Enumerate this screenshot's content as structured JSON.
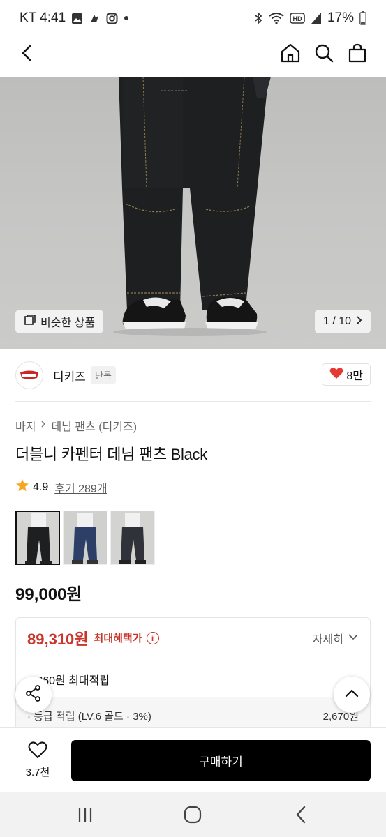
{
  "status_bar": {
    "carrier_time": "KT 4:41",
    "left_icons": [
      "gallery-icon",
      "app-notification-icon",
      "instagram-icon",
      "more-dot-icon"
    ],
    "right_icons": [
      "bluetooth-icon",
      "wifi-icon",
      "hd-voice-icon",
      "signal-icon"
    ],
    "battery": "17%"
  },
  "top_nav": {
    "icons": [
      "back-arrow-icon",
      "home-icon",
      "search-icon",
      "shopping-bag-icon"
    ]
  },
  "hero": {
    "similar_label": "비슷한 상품",
    "counter": "1 / 10"
  },
  "brand": {
    "name": "디키즈",
    "badge": "단독",
    "likes": "8만"
  },
  "product": {
    "breadcrumb": [
      "바지",
      "데님 팬츠 (디키즈)"
    ],
    "title": "더블니 카펜터 데님 팬츠 Black",
    "rating": "4.9",
    "reviews": "후기 289개",
    "price": "99,000원",
    "thumbnails": [
      "black",
      "indigo",
      "charcoal"
    ]
  },
  "benefit": {
    "sale_price": "89,310원",
    "sale_label": "최대혜택가",
    "detail_label": "자세히",
    "points_title": "6,260원 최대적립",
    "points_row_label": "· 등급 적립 (LV.6 골드 · 3%)",
    "points_row_value": "2,670원"
  },
  "bottom": {
    "wish_count": "3.7천",
    "buy_label": "구매하기"
  },
  "colors": {
    "accent_red": "#c9352a",
    "buy_button": "#000000",
    "heart": "#e53935"
  }
}
